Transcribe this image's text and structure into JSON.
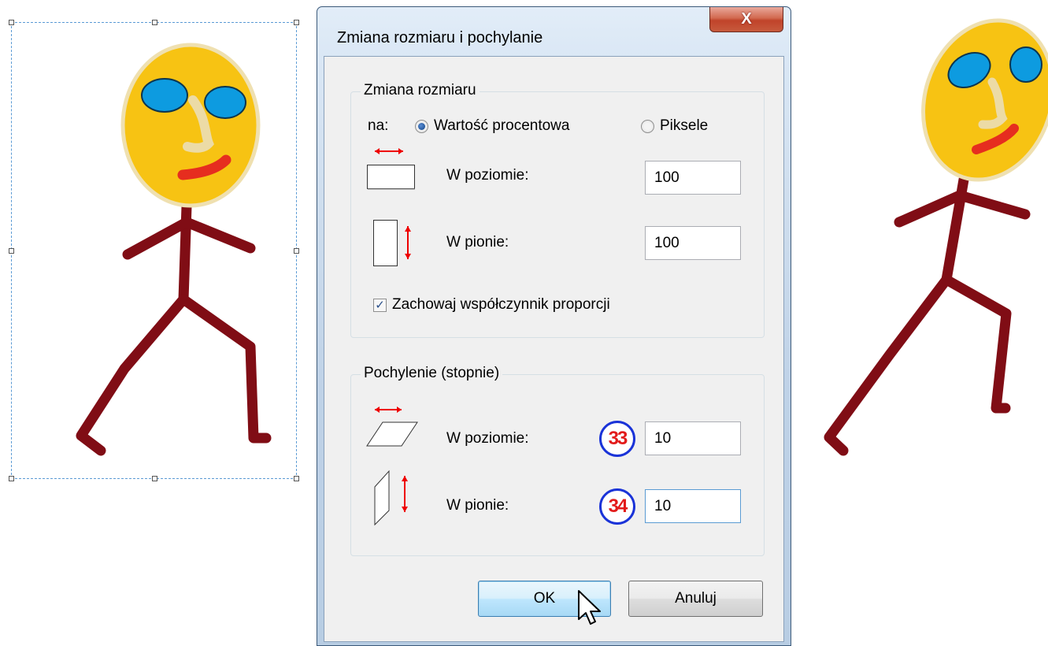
{
  "dialog": {
    "title": "Zmiana rozmiaru i pochylanie",
    "close_label": "X",
    "resize": {
      "group_title": "Zmiana rozmiaru",
      "by_label": "na:",
      "options": [
        {
          "label": "Wartość procentowa",
          "checked": true
        },
        {
          "label": "Piksele",
          "checked": false
        }
      ],
      "horizontal_label": "W poziomie:",
      "horizontal_value": "100",
      "vertical_label": "W pionie:",
      "vertical_value": "100",
      "keep_ratio_label": "Zachowaj współczynnik proporcji",
      "keep_ratio_checked": true
    },
    "skew": {
      "group_title": "Pochylenie (stopnie)",
      "horizontal_label": "W poziomie:",
      "horizontal_value": "10",
      "horizontal_badge": "33",
      "vertical_label": "W pionie:",
      "vertical_value": "10",
      "vertical_badge": "34"
    },
    "ok_label": "OK",
    "cancel_label": "Anuluj"
  },
  "colors": {
    "face": "#f7c313",
    "face_outline": "#efe0b0",
    "eyes": "#0d9be0",
    "nose": "#ecdba6",
    "mouth": "#e62d1f",
    "body": "#800d15",
    "selection": "#5b9bd5",
    "badge_ring": "#1a33d8",
    "badge_text": "#e21b1b"
  }
}
